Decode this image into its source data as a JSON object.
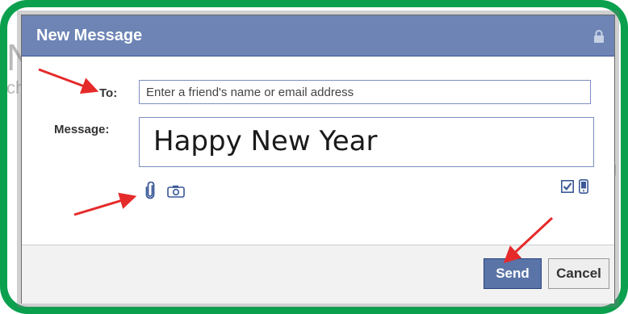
{
  "background": {
    "letters": {
      "m": "N",
      "ch": "ch",
      "g": "g"
    }
  },
  "dialog": {
    "title": "New Message",
    "title_icon": "lock-icon",
    "to_label": "To:",
    "to_placeholder": "Enter a friend's name or email address",
    "to_value": "",
    "message_label": "Message:",
    "message_value": "Happy New Year",
    "attach_icons": [
      "paperclip-icon",
      "camera-icon"
    ],
    "right_icons": [
      "checkbox-checked-icon",
      "mobile-phone-icon"
    ],
    "buttons": {
      "send_label": "Send",
      "cancel_label": "Cancel"
    }
  },
  "colors": {
    "frame_green": "#0aa04e",
    "titlebar_blue": "#6d84b4",
    "send_button_blue": "#5b74a8",
    "arrow_red": "#e52a2a"
  }
}
